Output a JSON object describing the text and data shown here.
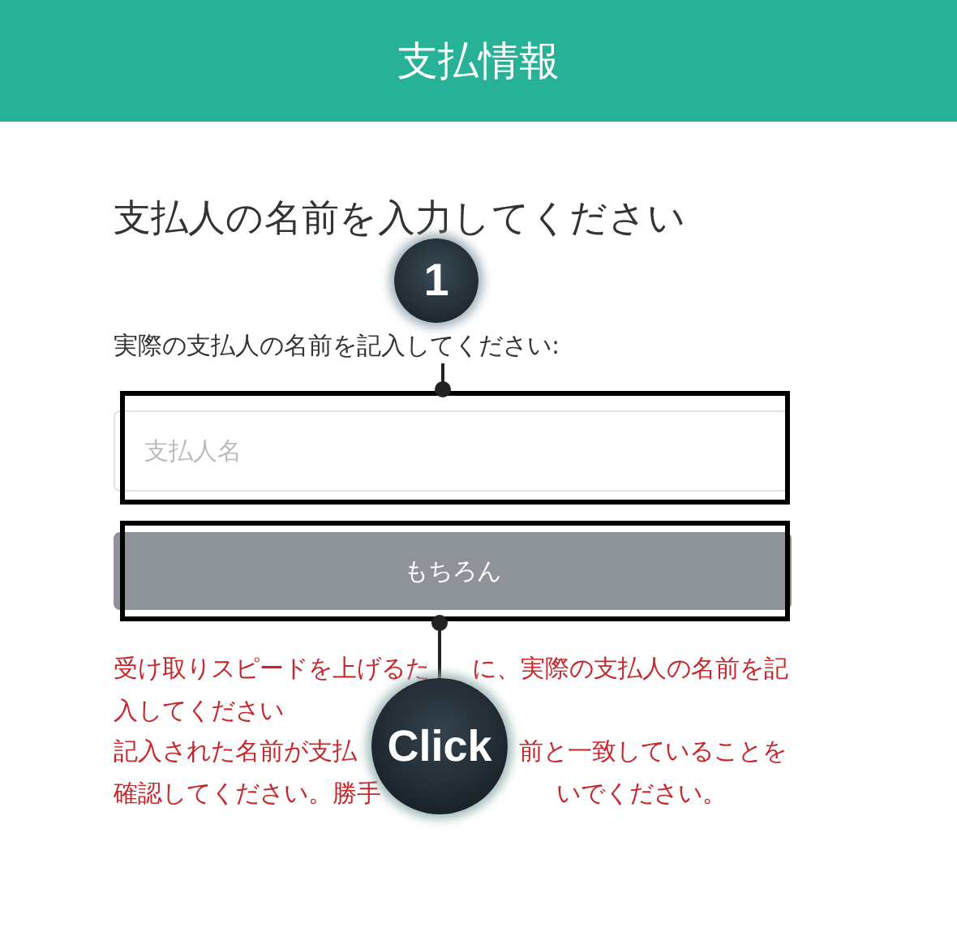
{
  "header": {
    "title": "支払情報"
  },
  "heading": "支払人の名前を入力してください",
  "label": "実際の支払人の名前を記入してください:",
  "name_field": {
    "placeholder": "支払人名"
  },
  "submit_button": {
    "label": "もちろん"
  },
  "notes": [
    [
      "受け取りスピードを上げるた",
      "に、実際の支払人の名前を記"
    ],
    [
      "入してください"
    ],
    [
      "記入された名前が支払",
      "前と一致していることを"
    ],
    [
      "確認してください。勝手",
      "いでください。"
    ]
  ],
  "callouts": [
    {
      "label": "1"
    },
    {
      "label": "Click"
    }
  ]
}
